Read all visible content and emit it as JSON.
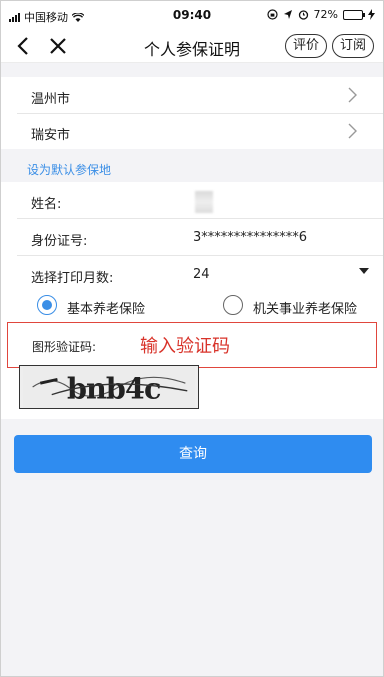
{
  "status_bar": {
    "carrier": "中国移动",
    "time": "09:40",
    "battery_percent": "72%",
    "battery_level": 0.72
  },
  "nav": {
    "back_icon": "chevron-left-icon",
    "close_icon": "close-icon",
    "title": "个人参保证明",
    "rate_label": "评价",
    "subscribe_label": "订阅"
  },
  "location": {
    "city": "温州市",
    "district": "瑞安市",
    "set_default_link": "设为默认参保地"
  },
  "form": {
    "name_label": "姓名:",
    "id_label": "身份证号:",
    "id_value": "3***************6",
    "month_label": "选择打印月数:",
    "month_value": "24",
    "radio_basic": "基本养老保险",
    "radio_institution": "机关事业养老保险",
    "radio_selected": "basic",
    "captcha_label": "图形验证码:",
    "captcha_hint": "输入验证码",
    "captcha_text": "bnb4c"
  },
  "actions": {
    "query_label": "查询"
  },
  "colors": {
    "accent": "#2f8cf0",
    "link": "#3a8ee6",
    "highlight_red": "#e0463d"
  }
}
